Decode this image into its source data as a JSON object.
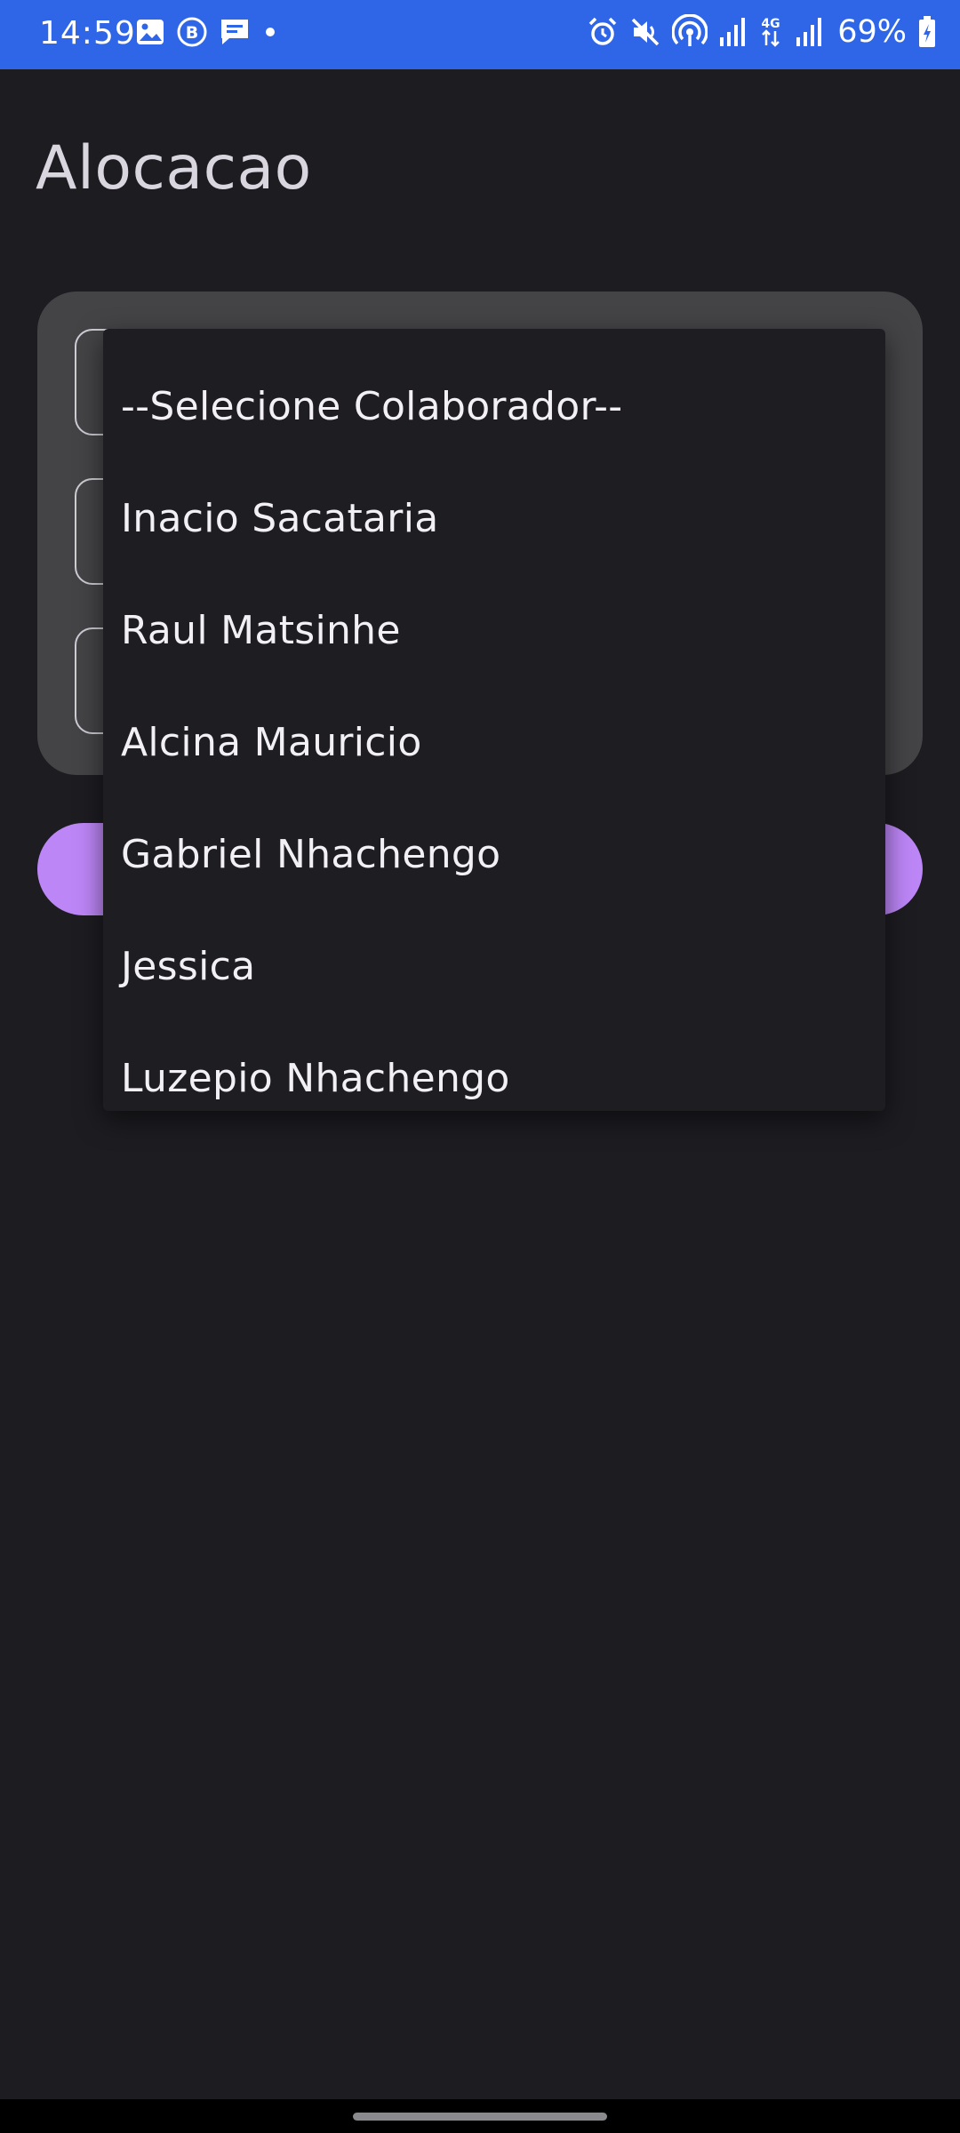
{
  "status_bar": {
    "time": "14:59",
    "battery": "69%",
    "network": "4G",
    "left_icons": [
      "image-icon",
      "b-badge-icon",
      "message-icon",
      "dot-icon"
    ],
    "right_icons": [
      "alarm-icon",
      "mute-icon",
      "hotspot-icon",
      "signal-icon",
      "signal-4g-icon",
      "signal-icon-2",
      "battery-charging-icon"
    ]
  },
  "page": {
    "title": "Alocacao"
  },
  "dropdown": {
    "items": [
      "--Selecione Colaborador--",
      "Inacio Sacataria",
      "Raul Matsinhe",
      "Alcina Mauricio",
      "Gabriel Nhachengo",
      "Jessica",
      "Luzepio Nhachengo"
    ]
  },
  "colors": {
    "status_bar_bg": "#2f66e8",
    "background": "#1d1c21",
    "card": "#444447",
    "accent_button": "#bd86f7",
    "dropdown_bg": "#1e1d22"
  }
}
